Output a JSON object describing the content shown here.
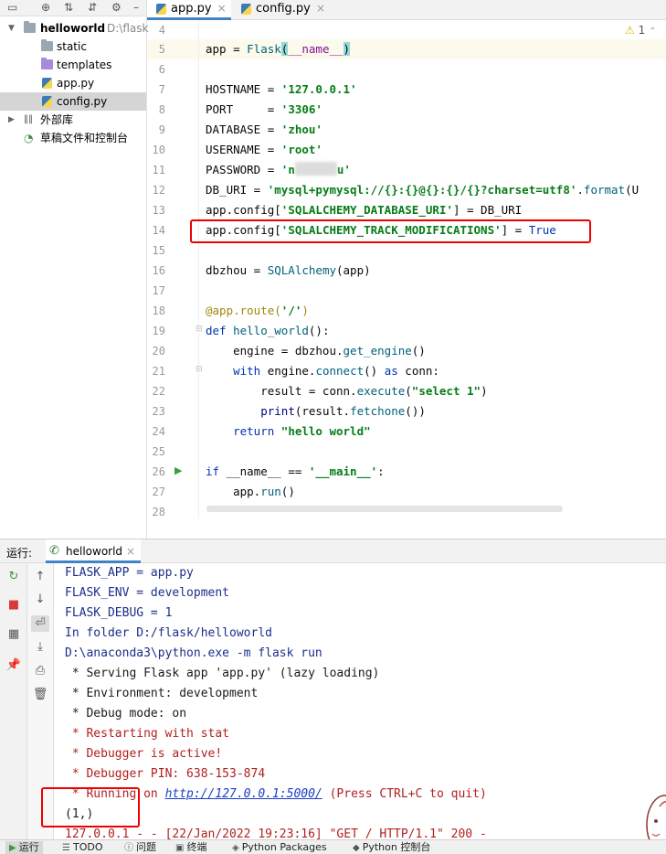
{
  "project": {
    "root_name": "helloworld",
    "root_path": "D:\\flask",
    "items": [
      {
        "label": "static",
        "type": "folder"
      },
      {
        "label": "templates",
        "type": "folder-templates"
      },
      {
        "label": "app.py",
        "type": "python-file"
      },
      {
        "label": "config.py",
        "type": "python-file",
        "selected": true
      }
    ],
    "external_libs": "外部库",
    "scratches": "草稿文件和控制台"
  },
  "editor": {
    "tabs": [
      {
        "label": "app.py",
        "active": true
      },
      {
        "label": "config.py",
        "active": false
      }
    ],
    "warning_count": "1",
    "line_numbers": [
      "4",
      "5",
      "6",
      "7",
      "8",
      "9",
      "10",
      "11",
      "12",
      "13",
      "14",
      "15",
      "16",
      "17",
      "18",
      "19",
      "20",
      "21",
      "22",
      "23",
      "24",
      "25",
      "26",
      "27",
      "28"
    ],
    "code": {
      "l5_a": "app = ",
      "l5_b": "Flask",
      "l5_c": "(",
      "l5_d": "__name__",
      "l5_e": ")",
      "l7_a": "HOSTNAME = ",
      "l7_b": "'127.0.0.1'",
      "l8_a": "PORT     = ",
      "l8_b": "'3306'",
      "l9_a": "DATABASE = ",
      "l9_b": "'zhou'",
      "l10_a": "USERNAME = ",
      "l10_b": "'root'",
      "l11_a": "PASSWORD = ",
      "l11_b": "'n",
      "l11_c": "u'",
      "l12_a": "DB_URI = ",
      "l12_b": "'mysql+pymysql://{}:{}@{}:{}/{}?charset=utf8'",
      "l12_c": ".",
      "l12_d": "format",
      "l12_e": "(U",
      "l13_a": "app.config[",
      "l13_b": "'SQLALCHEMY_DATABASE_URI'",
      "l13_c": "] = DB_URI",
      "l14_a": "app.config[",
      "l14_b": "'SQLALCHEMY_TRACK_MODIFICATIONS'",
      "l14_c": "] = ",
      "l14_d": "True",
      "l16_a": "dbzhou",
      "l16_b": " = ",
      "l16_c": "SQLAlchemy",
      "l16_d": "(app)",
      "l18_a": "@app.route(",
      "l18_b": "'/'",
      "l18_c": ")",
      "l19_a": "def ",
      "l19_b": "hello_world",
      "l19_c": "():",
      "l20_a": "    engine = dbzhou.",
      "l20_b": "get_engine",
      "l20_c": "()",
      "l21_a": "    ",
      "l21_b": "with",
      "l21_c": " engine.",
      "l21_d": "connect",
      "l21_e": "() ",
      "l21_f": "as",
      "l21_g": " conn:",
      "l22_a": "        result = conn.",
      "l22_b": "execute",
      "l22_c": "(",
      "l22_d": "\"select 1\"",
      "l22_e": ")",
      "l23_a": "        ",
      "l23_b": "print",
      "l23_c": "(result.",
      "l23_d": "fetchone",
      "l23_e": "())",
      "l24_a": "    ",
      "l24_b": "return",
      "l24_c": " ",
      "l24_d": "\"hello world\"",
      "l26_a": "if",
      "l26_b": " __name__ == ",
      "l26_c": "'__main__'",
      "l26_d": ":",
      "l27_a": "    app.",
      "l27_b": "run",
      "l27_c": "()"
    }
  },
  "run": {
    "label": "运行:",
    "tab_label": "helloworld",
    "console": {
      "l1": "FLASK_APP = app.py",
      "l2": "FLASK_ENV = development",
      "l3": "FLASK_DEBUG = 1",
      "l4": "In folder D:/flask/helloworld",
      "l5": "D:\\anaconda3\\python.exe -m flask run",
      "l6": " * Serving Flask app 'app.py' (lazy loading)",
      "l7": " * Environment: development",
      "l8": " * Debug mode: on",
      "l9": " * Restarting with stat",
      "l10": " * Debugger is active!",
      "l11": " * Debugger PIN: 638-153-874",
      "l12_a": " * Running on ",
      "l12_b": "http://127.0.0.1:5000/",
      "l12_c": " (Press CTRL+C to quit)",
      "l13": "(1,)",
      "l14": "127.0.0.1 - - [22/Jan/2022 19:23:16] \"GET / HTTP/1.1\" 200 -"
    }
  },
  "statusbar": {
    "items": [
      "运行",
      "TODO",
      "问题",
      "终端",
      "Python Packages",
      "Python 控制台"
    ]
  },
  "colors": {
    "accent": "#4083c9",
    "highlight_box": "#e00000",
    "string": "#067d17",
    "keyword": "#0033b3"
  }
}
